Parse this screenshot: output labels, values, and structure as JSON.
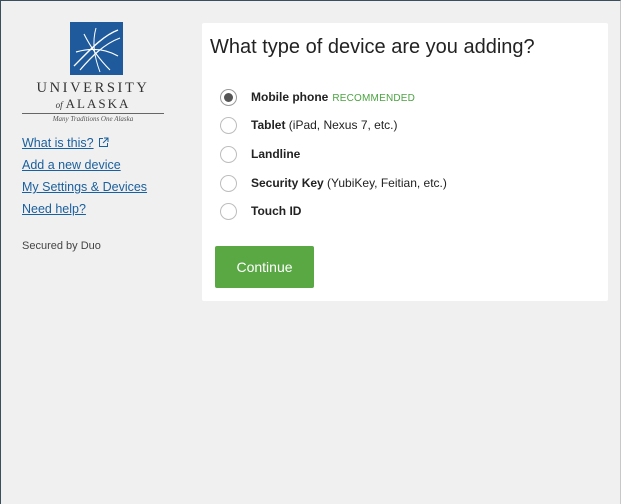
{
  "sidebar": {
    "logo": {
      "name_line1": "UNIVERSITY",
      "name_of": "of",
      "name_line2": "ALASKA",
      "tagline": "Many Traditions One Alaska"
    },
    "links": {
      "what_is_this": "What is this?",
      "add_device": "Add a new device",
      "settings": "My Settings & Devices",
      "help": "Need help?"
    },
    "secured_by": "Secured by Duo"
  },
  "main": {
    "title": "What type of device are you adding?",
    "options": [
      {
        "label": "Mobile phone",
        "detail": "",
        "badge": "RECOMMENDED",
        "selected": true
      },
      {
        "label": "Tablet",
        "detail": " (iPad, Nexus 7, etc.)",
        "badge": "",
        "selected": false
      },
      {
        "label": "Landline",
        "detail": "",
        "badge": "",
        "selected": false
      },
      {
        "label": "Security Key",
        "detail": " (YubiKey, Feitian, etc.)",
        "badge": "",
        "selected": false
      },
      {
        "label": "Touch ID",
        "detail": "",
        "badge": "",
        "selected": false
      }
    ],
    "continue_label": "Continue"
  },
  "colors": {
    "accent_green": "#5aa844",
    "recommended_green": "#4aa340",
    "link_blue": "#1a5f9e",
    "logo_blue": "#1f5a9c"
  },
  "icons": [
    "logo-mark",
    "external-link-icon",
    "radio-checked",
    "radio-unchecked"
  ]
}
